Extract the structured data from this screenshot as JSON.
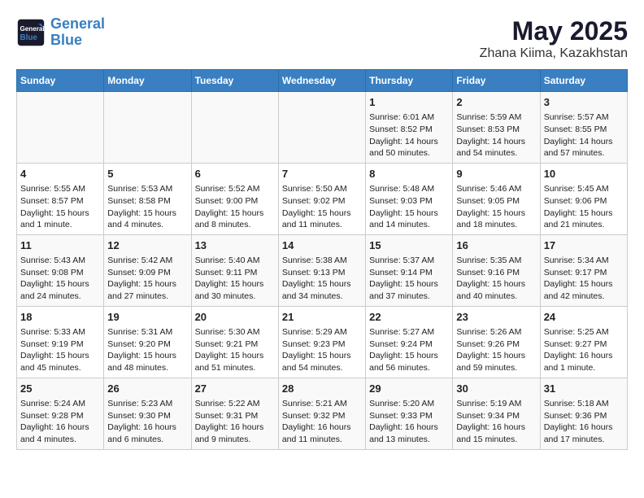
{
  "logo": {
    "line1": "General",
    "line2": "Blue"
  },
  "title": "May 2025",
  "subtitle": "Zhana Kiima, Kazakhstan",
  "days_of_week": [
    "Sunday",
    "Monday",
    "Tuesday",
    "Wednesday",
    "Thursday",
    "Friday",
    "Saturday"
  ],
  "weeks": [
    [
      {
        "day": "",
        "info": ""
      },
      {
        "day": "",
        "info": ""
      },
      {
        "day": "",
        "info": ""
      },
      {
        "day": "",
        "info": ""
      },
      {
        "day": "1",
        "info": "Sunrise: 6:01 AM\nSunset: 8:52 PM\nDaylight: 14 hours\nand 50 minutes."
      },
      {
        "day": "2",
        "info": "Sunrise: 5:59 AM\nSunset: 8:53 PM\nDaylight: 14 hours\nand 54 minutes."
      },
      {
        "day": "3",
        "info": "Sunrise: 5:57 AM\nSunset: 8:55 PM\nDaylight: 14 hours\nand 57 minutes."
      }
    ],
    [
      {
        "day": "4",
        "info": "Sunrise: 5:55 AM\nSunset: 8:57 PM\nDaylight: 15 hours\nand 1 minute."
      },
      {
        "day": "5",
        "info": "Sunrise: 5:53 AM\nSunset: 8:58 PM\nDaylight: 15 hours\nand 4 minutes."
      },
      {
        "day": "6",
        "info": "Sunrise: 5:52 AM\nSunset: 9:00 PM\nDaylight: 15 hours\nand 8 minutes."
      },
      {
        "day": "7",
        "info": "Sunrise: 5:50 AM\nSunset: 9:02 PM\nDaylight: 15 hours\nand 11 minutes."
      },
      {
        "day": "8",
        "info": "Sunrise: 5:48 AM\nSunset: 9:03 PM\nDaylight: 15 hours\nand 14 minutes."
      },
      {
        "day": "9",
        "info": "Sunrise: 5:46 AM\nSunset: 9:05 PM\nDaylight: 15 hours\nand 18 minutes."
      },
      {
        "day": "10",
        "info": "Sunrise: 5:45 AM\nSunset: 9:06 PM\nDaylight: 15 hours\nand 21 minutes."
      }
    ],
    [
      {
        "day": "11",
        "info": "Sunrise: 5:43 AM\nSunset: 9:08 PM\nDaylight: 15 hours\nand 24 minutes."
      },
      {
        "day": "12",
        "info": "Sunrise: 5:42 AM\nSunset: 9:09 PM\nDaylight: 15 hours\nand 27 minutes."
      },
      {
        "day": "13",
        "info": "Sunrise: 5:40 AM\nSunset: 9:11 PM\nDaylight: 15 hours\nand 30 minutes."
      },
      {
        "day": "14",
        "info": "Sunrise: 5:38 AM\nSunset: 9:13 PM\nDaylight: 15 hours\nand 34 minutes."
      },
      {
        "day": "15",
        "info": "Sunrise: 5:37 AM\nSunset: 9:14 PM\nDaylight: 15 hours\nand 37 minutes."
      },
      {
        "day": "16",
        "info": "Sunrise: 5:35 AM\nSunset: 9:16 PM\nDaylight: 15 hours\nand 40 minutes."
      },
      {
        "day": "17",
        "info": "Sunrise: 5:34 AM\nSunset: 9:17 PM\nDaylight: 15 hours\nand 42 minutes."
      }
    ],
    [
      {
        "day": "18",
        "info": "Sunrise: 5:33 AM\nSunset: 9:19 PM\nDaylight: 15 hours\nand 45 minutes."
      },
      {
        "day": "19",
        "info": "Sunrise: 5:31 AM\nSunset: 9:20 PM\nDaylight: 15 hours\nand 48 minutes."
      },
      {
        "day": "20",
        "info": "Sunrise: 5:30 AM\nSunset: 9:21 PM\nDaylight: 15 hours\nand 51 minutes."
      },
      {
        "day": "21",
        "info": "Sunrise: 5:29 AM\nSunset: 9:23 PM\nDaylight: 15 hours\nand 54 minutes."
      },
      {
        "day": "22",
        "info": "Sunrise: 5:27 AM\nSunset: 9:24 PM\nDaylight: 15 hours\nand 56 minutes."
      },
      {
        "day": "23",
        "info": "Sunrise: 5:26 AM\nSunset: 9:26 PM\nDaylight: 15 hours\nand 59 minutes."
      },
      {
        "day": "24",
        "info": "Sunrise: 5:25 AM\nSunset: 9:27 PM\nDaylight: 16 hours\nand 1 minute."
      }
    ],
    [
      {
        "day": "25",
        "info": "Sunrise: 5:24 AM\nSunset: 9:28 PM\nDaylight: 16 hours\nand 4 minutes."
      },
      {
        "day": "26",
        "info": "Sunrise: 5:23 AM\nSunset: 9:30 PM\nDaylight: 16 hours\nand 6 minutes."
      },
      {
        "day": "27",
        "info": "Sunrise: 5:22 AM\nSunset: 9:31 PM\nDaylight: 16 hours\nand 9 minutes."
      },
      {
        "day": "28",
        "info": "Sunrise: 5:21 AM\nSunset: 9:32 PM\nDaylight: 16 hours\nand 11 minutes."
      },
      {
        "day": "29",
        "info": "Sunrise: 5:20 AM\nSunset: 9:33 PM\nDaylight: 16 hours\nand 13 minutes."
      },
      {
        "day": "30",
        "info": "Sunrise: 5:19 AM\nSunset: 9:34 PM\nDaylight: 16 hours\nand 15 minutes."
      },
      {
        "day": "31",
        "info": "Sunrise: 5:18 AM\nSunset: 9:36 PM\nDaylight: 16 hours\nand 17 minutes."
      }
    ]
  ]
}
